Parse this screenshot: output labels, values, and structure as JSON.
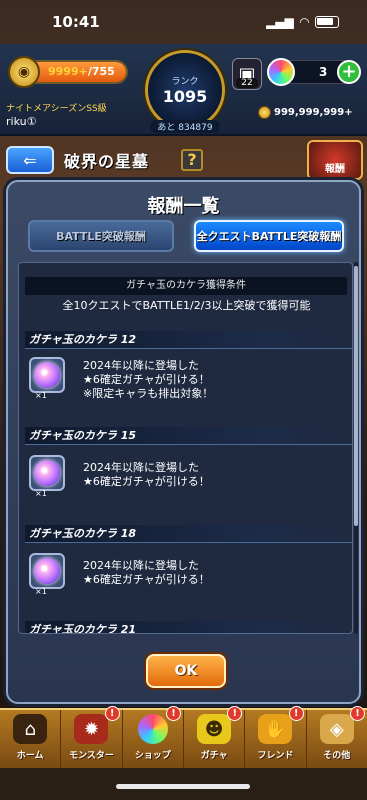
{
  "status": {
    "time": "10:41"
  },
  "hud": {
    "stamina_current": "9999+",
    "stamina_max": "/755",
    "rank_label": "ランク",
    "rank_value": "1095",
    "rank_next": "あと 834879",
    "orb_badge": "22",
    "gem_count": "3",
    "gem_plus": "+",
    "season": "ナイトメアシーズンSS級",
    "username": "riku①",
    "coins": "999,999,999+"
  },
  "header": {
    "back": "⇐",
    "title": "破界の星墓",
    "help": "?",
    "boss_label": "報酬"
  },
  "modal": {
    "title": "報酬一覧",
    "tabs": [
      {
        "label": "BATTLE突破報酬",
        "selected": false
      },
      {
        "label": "全クエストBATTLE突破報酬",
        "selected": true
      }
    ],
    "condition_header": "ガチャ玉のカケラ獲得条件",
    "condition_text": "全10クエストでBATTLE1/2/3以上突破で獲得可能",
    "rewards": [
      {
        "name": "ガチャ玉のカケラ 12",
        "qty": "×1",
        "desc": "2024年以降に登場した\n★6確定ガチャが引ける！\n※限定キャラも排出対象！"
      },
      {
        "name": "ガチャ玉のカケラ 15",
        "qty": "×1",
        "desc": "2024年以降に登場した\n★6確定ガチャが引ける！"
      },
      {
        "name": "ガチャ玉のカケラ 18",
        "qty": "×1",
        "desc": "2024年以降に登場した\n★6確定ガチャが引ける！"
      },
      {
        "name": "ガチャ玉のカケラ 21",
        "qty": "",
        "desc": ""
      }
    ],
    "ok": "OK"
  },
  "nav": [
    {
      "label": "ホーム",
      "icon": "home-icon",
      "badge": ""
    },
    {
      "label": "モンスター",
      "icon": "monster-icon",
      "badge": "!"
    },
    {
      "label": "ショップ",
      "icon": "shop-orb-icon",
      "badge": "!"
    },
    {
      "label": "ガチャ",
      "icon": "gacha-icon",
      "badge": "!"
    },
    {
      "label": "フレンド",
      "icon": "friend-icon",
      "badge": "!"
    },
    {
      "label": "その他",
      "icon": "other-icon",
      "badge": "!"
    }
  ]
}
